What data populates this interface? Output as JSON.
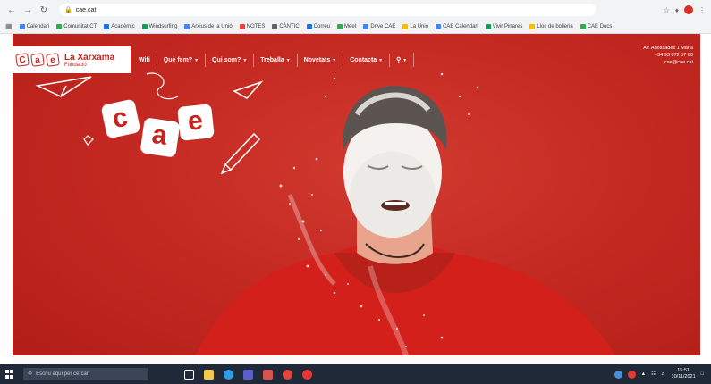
{
  "browser": {
    "url": "cae.cat",
    "bookmarks": [
      "Calendari",
      "Comunitat CT",
      "Acadèmic",
      "Windsurfing",
      "Arxius de la Unió",
      "NOTES",
      "CÀNTIC",
      "Correu",
      "Meet",
      "Drive CAE",
      "La Unió",
      "CAE Calendari",
      "Vivir Pinares",
      "Lloc de bolleria",
      "CAE Docs"
    ],
    "colors": {
      "chrome": "#f1f3f4"
    }
  },
  "site": {
    "logo": {
      "letters": [
        "C",
        "a",
        "e"
      ],
      "name": "La Xarxama",
      "subtitle": "Fundació"
    },
    "menu": [
      {
        "label": "Què fem?",
        "has_dropdown": true
      },
      {
        "label": "Qui som?",
        "has_dropdown": true
      },
      {
        "label": "Treballa",
        "has_dropdown": true
      },
      {
        "label": "Novetats",
        "has_dropdown": true
      },
      {
        "label": "Contacta",
        "has_dropdown": true
      }
    ],
    "menu_prefix": "Wifi",
    "contact": [
      "Av. Adossades 1 Maria",
      "+34 93 872 57 80",
      "cae@cae.cat"
    ],
    "hero_logo_letters": [
      "c",
      "a",
      "e"
    ],
    "colors": {
      "brand_red": "#c7241f",
      "hero_red": "#c52a22"
    }
  },
  "taskbar": {
    "search_placeholder": "Escriu aquí per cercar",
    "time": "15:51",
    "date": "10/11/2021",
    "apps": [
      "file-explorer-icon",
      "edge-icon",
      "chrome-icon",
      "teams-icon",
      "word-icon",
      "outlook-icon"
    ]
  }
}
